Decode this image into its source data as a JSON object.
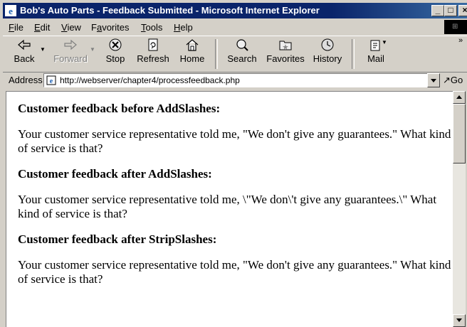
{
  "window": {
    "title": "Bob's Auto Parts - Feedback Submitted - Microsoft Internet Explorer",
    "controls": {
      "minimize": "_",
      "maximize": "□",
      "close": "×"
    }
  },
  "menu": [
    {
      "label": "File",
      "key": "F",
      "rest": "ile"
    },
    {
      "label": "Edit",
      "key": "E",
      "rest": "dit"
    },
    {
      "label": "View",
      "key": "V",
      "rest": "iew"
    },
    {
      "label": "Favorites",
      "key": "a",
      "pre": "F",
      "rest": "vorites"
    },
    {
      "label": "Tools",
      "key": "T",
      "rest": "ools"
    },
    {
      "label": "Help",
      "key": "H",
      "rest": "elp"
    }
  ],
  "toolbar": {
    "back": "Back",
    "forward": "Forward",
    "stop": "Stop",
    "refresh": "Refresh",
    "home": "Home",
    "search": "Search",
    "favorites": "Favorites",
    "history": "History",
    "mail": "Mail"
  },
  "address": {
    "label": "Address",
    "url": "http://webserver/chapter4/processfeedback.php",
    "go": "Go"
  },
  "page": {
    "heading1": "Customer feedback before AddSlashes:",
    "text1": "Your customer service representative told me, \"We don't give any guarantees.\" What kind of service is that?",
    "heading2": "Customer feedback after AddSlashes:",
    "text2": "Your customer service representative told me, \\\"We don\\'t give any guarantees.\\\" What kind of service is that?",
    "heading3": "Customer feedback after StripSlashes:",
    "text3": "Your customer service representative told me, \"We don't give any guarantees.\" What kind of service is that?"
  },
  "colors": {
    "titlebar": "#0a246a",
    "chrome": "#d4d0c8",
    "content": "#ffffff"
  }
}
